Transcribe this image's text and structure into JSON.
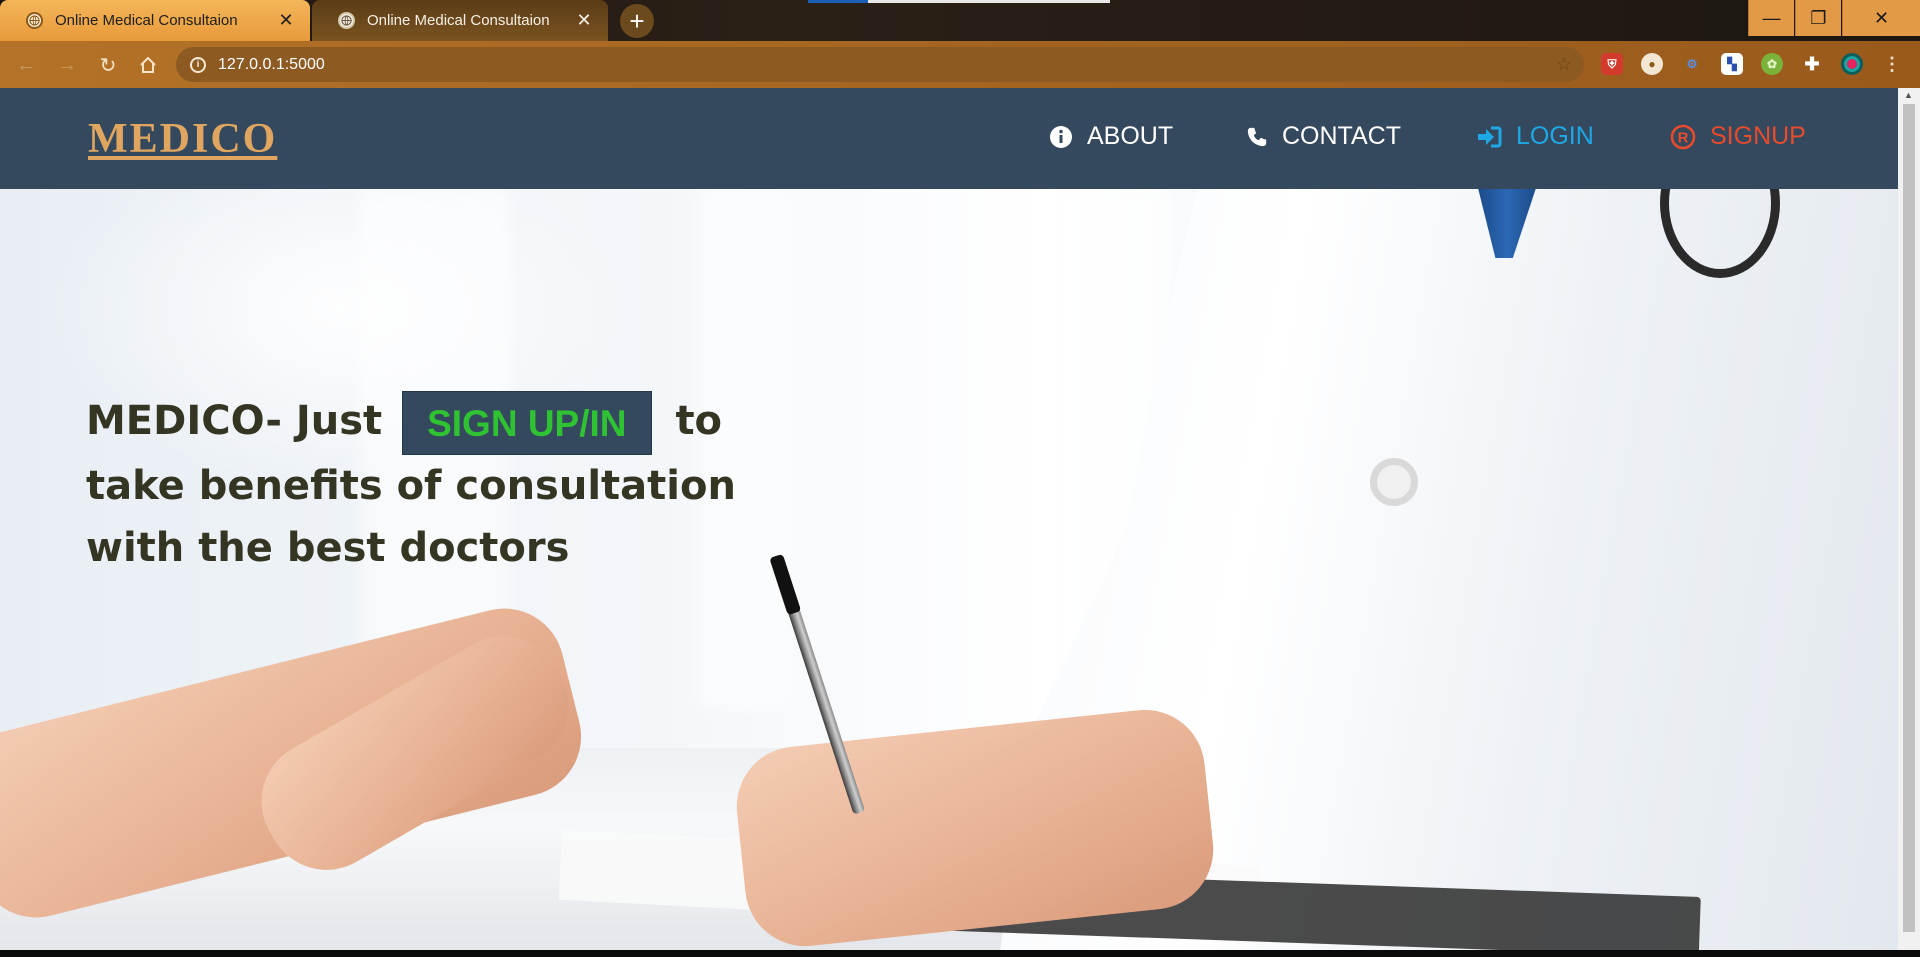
{
  "browser": {
    "tabs": [
      {
        "title": "Online Medical Consultaion",
        "close": "✕",
        "active": true
      },
      {
        "title": "Online Medical Consultaion",
        "close": "✕",
        "active": false
      }
    ],
    "new_tab": "+",
    "window_controls": {
      "minimize": "—",
      "restore": "❐",
      "close": "✕"
    },
    "address": "127.0.0.1:5000",
    "nav_icons": [
      "back-arrow-icon",
      "forward-arrow-icon",
      "reload-icon",
      "home-icon"
    ],
    "extensions": [
      "shield-extension-icon",
      "lock-extension-icon",
      "translate-extension-icon",
      "flag-extension-icon",
      "green-extension-icon",
      "puzzle-icon",
      "profile-avatar-icon",
      "kebab-menu-icon"
    ]
  },
  "navbar": {
    "logo": "MEDICO",
    "items": [
      {
        "label": "ABOUT",
        "icon": "info-circle-icon",
        "color": "#ffffff"
      },
      {
        "label": "CONTACT",
        "icon": "phone-icon",
        "color": "#ffffff"
      },
      {
        "label": "LOGIN",
        "icon": "sign-in-icon",
        "color": "#1ea8e6"
      },
      {
        "label": "SIGNUP",
        "icon": "registered-icon",
        "color": "#e84b2c"
      }
    ],
    "background": "#34495e"
  },
  "hero": {
    "prefix": "MEDICO- Just",
    "cta": "SIGN UP/IN",
    "suffix": "to take benefits of consultation with the best doctors",
    "text_color": "#353523",
    "cta_color": "#2fc232"
  }
}
